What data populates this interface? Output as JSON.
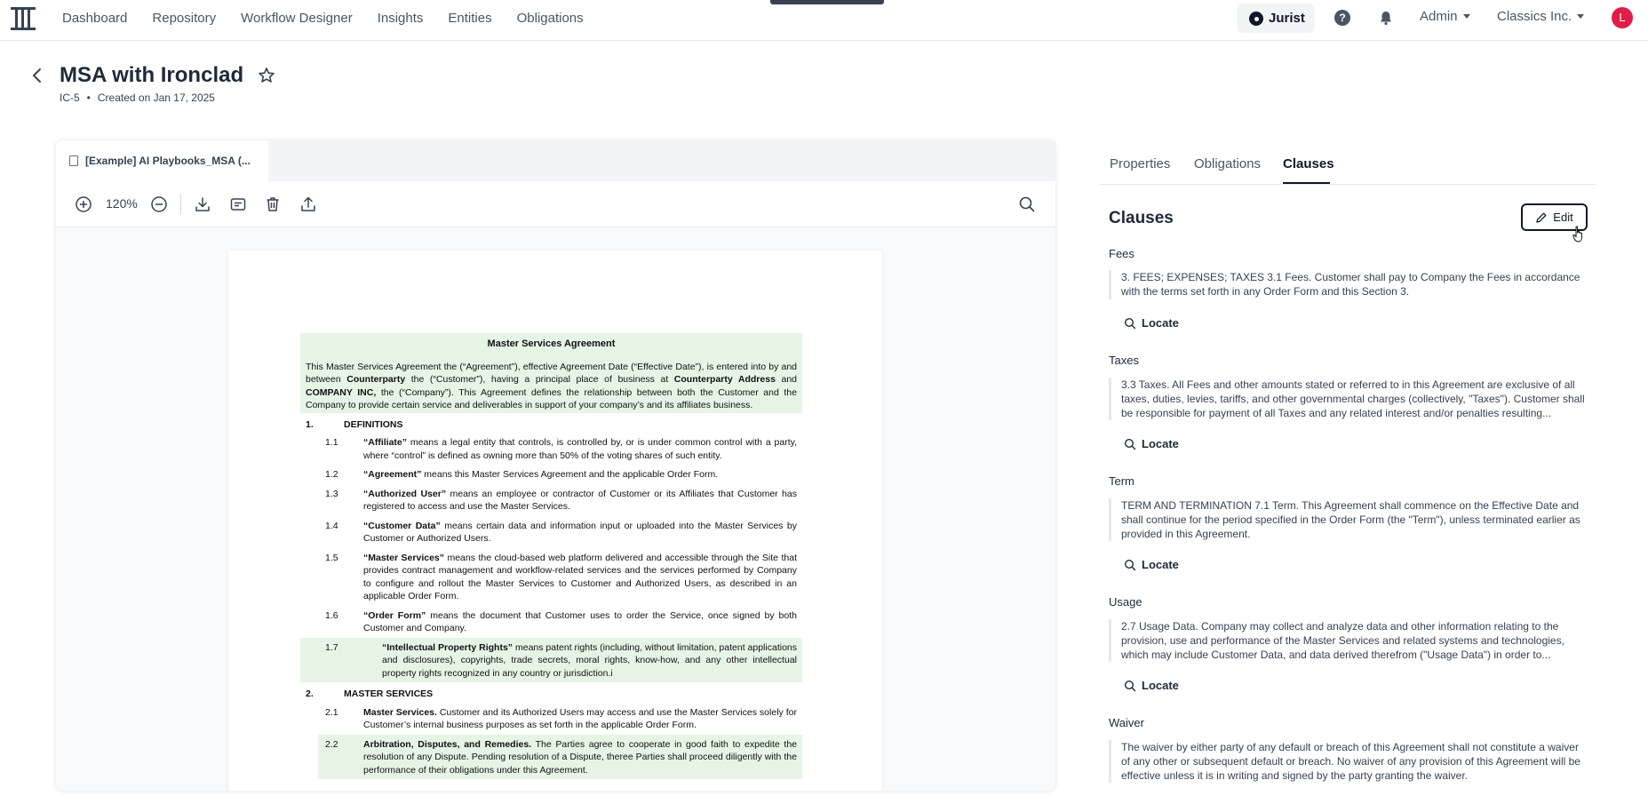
{
  "nav": {
    "items": [
      "Dashboard",
      "Repository",
      "Workflow Designer",
      "Insights",
      "Entities",
      "Obligations"
    ],
    "jurist_label": "Jurist",
    "admin_label": "Admin",
    "org_label": "Classics Inc.",
    "avatar_initial": "L"
  },
  "header": {
    "title": "MSA with Ironclad",
    "id": "IC-5",
    "separator": "•",
    "created": "Created on Jan 17, 2025"
  },
  "viewer": {
    "file_tab": "[Example] AI Playbooks_MSA (...",
    "zoom": "120%"
  },
  "document": {
    "title": "Master Services Agreement",
    "intro": {
      "p1": "This Master Services Agreement the (“Agreement”), effective Agreement Date (“Effective Date”), is entered into by and between ",
      "b1": "Counterparty",
      "p2": " the (“Customer”), having a principal place of business at ",
      "b2": "Counterparty Address",
      "p3": " and ",
      "b3": "COMPANY INC,",
      "p4": " the (“Company”). This Agreement defines the relationship between both the Customer and the Company to provide certain service and deliverables in support of your company’s and its affiliates business."
    },
    "sections": [
      {
        "num": "1.",
        "title": "DEFINITIONS"
      },
      {
        "num": "2.",
        "title": "MASTER SERVICES"
      }
    ],
    "defs": [
      {
        "num": "1.1",
        "term": "“Affiliate”",
        "text": " means a legal entity that controls, is controlled by, or is under common control with a party, where “control” is defined as owning more than 50% of the voting shares of such entity."
      },
      {
        "num": "1.2",
        "term": "“Agreement”",
        "text": " means this Master Services Agreement and the applicable Order Form."
      },
      {
        "num": "1.3",
        "term": "“Authorized User”",
        "text": " means an employee or contractor of Customer or its Affiliates that Customer has registered to access and use the Master Services."
      },
      {
        "num": "1.4",
        "term": "“Customer Data”",
        "text": " means certain data and information input or uploaded into the Master Services by Customer or Authorized Users."
      },
      {
        "num": "1.5",
        "term": "“Master Services”",
        "text": " means the cloud-based web platform delivered and accessible through the Site that provides contract management and workflow-related services and the services performed by Company to configure and rollout the Master Services to Customer and Authorized Users, as described in an applicable Order Form."
      },
      {
        "num": "1.6",
        "term": "“Order Form”",
        "text": " means the document that Customer uses to order the Service, once signed by both Customer and Company."
      },
      {
        "num": "1.7",
        "term": "“Intellectual Property Rights”",
        "text": " means patent rights (including, without limitation, patent applications and disclosures), copyrights, trade secrets, moral rights, know-how, and any other intellectual property rights recognized in any country or jurisdiction.i"
      }
    ],
    "services": [
      {
        "num": "2.1",
        "term": "Master Services.",
        "text": " Customer and its Authorized Users may access and use the Master Services solely for Customer’s internal business purposes as set forth in the applicable Order Form."
      },
      {
        "num": "2.2",
        "term": "Arbitration, Disputes, and Remedies.",
        "text": " The Parties agree to cooperate in good faith to expedite the resolution of any Dispute. Pending resolution of a Dispute, theree Parties shall proceed diligently with the performance of their obligations under this Agreement."
      }
    ]
  },
  "panel": {
    "tabs": [
      "Properties",
      "Obligations",
      "Clauses"
    ],
    "active_tab": "Clauses",
    "heading": "Clauses",
    "edit_label": "Edit",
    "locate_label": "Locate",
    "clauses": [
      {
        "label": "Fees",
        "text": "3. FEES; EXPENSES; TAXES 3.1 Fees. Customer shall pay to Company the Fees in accordance with the terms set forth in any Order Form and this Section 3."
      },
      {
        "label": "Taxes",
        "text": "3.3 Taxes. All Fees and other amounts stated or referred to in this Agreement are exclusive of all taxes, duties, levies, tariffs, and other governmental charges (collectively, \"Taxes\"). Customer shall be responsible for payment of all Taxes and any related interest and/or penalties resulting..."
      },
      {
        "label": "Term",
        "text": "TERM AND TERMINATION 7.1 Term. This Agreement shall commence on the Effective Date and shall continue for the period specified in the Order Form (the \"Term\"), unless terminated earlier as provided in this Agreement."
      },
      {
        "label": "Usage",
        "text": "2.7 Usage Data. Company may collect and analyze data and other information relating to the provision, use and performance of the Master Services and related systems and technologies, which may include Customer Data, and data derived therefrom (\"Usage Data\") in order to..."
      },
      {
        "label": "Waiver",
        "text": "The waiver by either party of any default or breach of this Agreement shall not constitute a waiver of any other or subsequent default or breach. No waiver of any provision of this Agreement will be effective unless it is in writing and signed by the party granting the waiver."
      }
    ]
  },
  "colors": {
    "accent": "#111827",
    "highlight": "#e6f4e6",
    "avatar": "#e11d48"
  },
  "icons": [
    "logo-icon",
    "help-icon",
    "bell-icon",
    "back-icon",
    "star-icon",
    "zoom-in-icon",
    "zoom-out-icon",
    "download-icon",
    "comment-icon",
    "trash-icon",
    "upload-icon",
    "search-icon",
    "pencil-icon",
    "locate-search-icon"
  ]
}
